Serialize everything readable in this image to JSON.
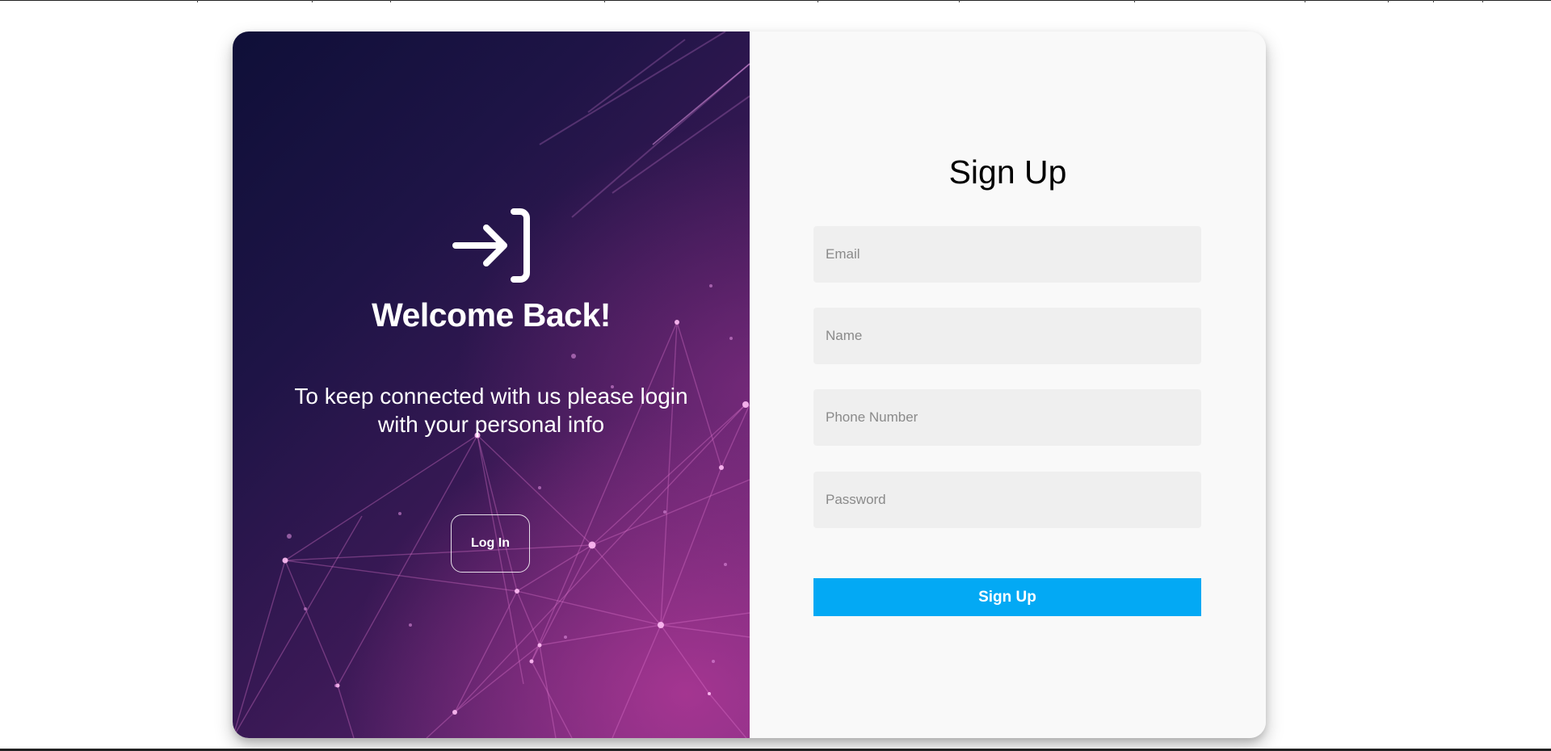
{
  "left_panel": {
    "title": "Welcome Back!",
    "message": "To keep connected with us please login with your personal info",
    "login_button_label": "Log In",
    "icon": "login-icon"
  },
  "right_panel": {
    "title": "Sign Up",
    "fields": {
      "email_placeholder": "Email",
      "name_placeholder": "Name",
      "phone_placeholder": "Phone Number",
      "password_placeholder": "Password"
    },
    "submit_label": "Sign Up"
  },
  "colors": {
    "accent": "#03a9f4",
    "panel_dark": "#0f0f38",
    "panel_magenta": "#6d2a7b",
    "field_bg": "#efefef",
    "form_bg": "#f9f9f9"
  }
}
